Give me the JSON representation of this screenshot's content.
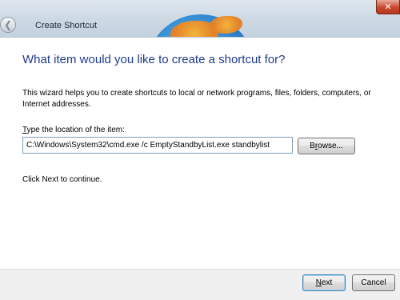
{
  "window": {
    "title": "Create Shortcut",
    "back_icon": "back-arrow-icon",
    "close_icon": "close-icon",
    "close_glyph": "✕",
    "back_glyph": "❮"
  },
  "main": {
    "heading": "What item would you like to create a shortcut for?",
    "description": "This wizard helps you to create shortcuts to local or network programs, files, folders, computers, or Internet addresses.",
    "field_label_accel": "T",
    "field_label_rest": "ype the location of the item:",
    "location_value": "C:\\Windows\\System32\\cmd.exe /c EmptyStandbyList.exe standbylist",
    "browse_accel": "r",
    "browse_pre": "B",
    "browse_post": "owse...",
    "footer_text": "Click Next to continue."
  },
  "buttons": {
    "next_accel": "N",
    "next_rest": "ext",
    "cancel_label": "Cancel"
  },
  "colors": {
    "heading": "#1e3b8a",
    "titlebar": "#cdd9e4",
    "close": "#c7492e",
    "command_area": "#f0f0f0"
  }
}
